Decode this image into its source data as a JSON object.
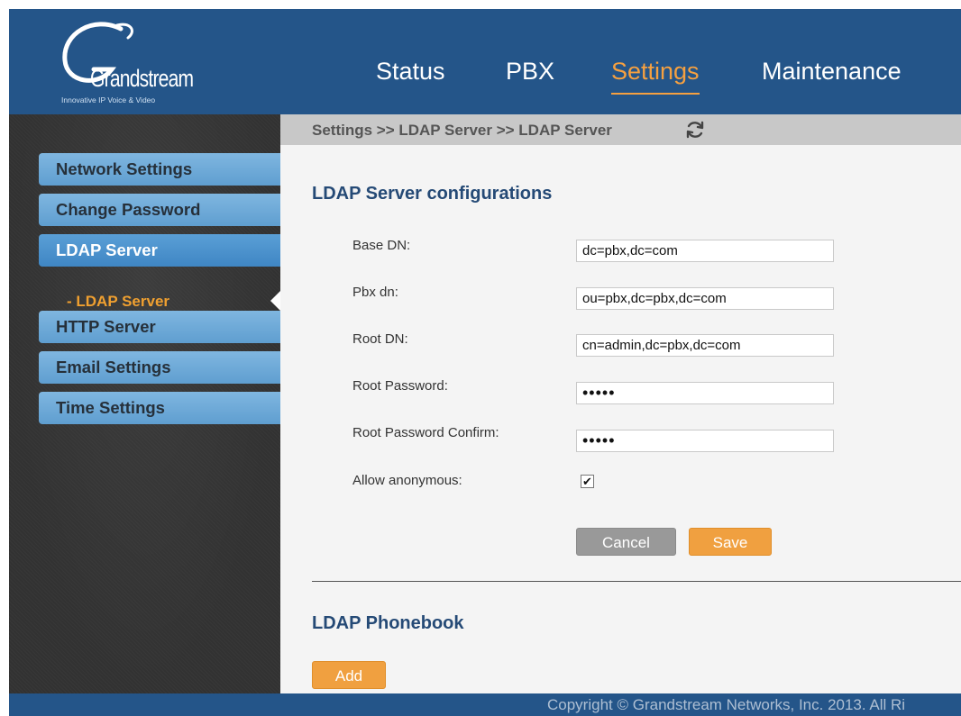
{
  "header": {
    "logo_text": "Grandstream",
    "logo_tagline": "Innovative IP Voice & Video",
    "nav": [
      {
        "label": "Status",
        "active": false
      },
      {
        "label": "PBX",
        "active": false
      },
      {
        "label": "Settings",
        "active": true
      },
      {
        "label": "Maintenance",
        "active": false
      }
    ]
  },
  "sidebar": {
    "items": [
      {
        "label": "Network Settings"
      },
      {
        "label": "Change Password"
      },
      {
        "label": "LDAP Server",
        "active": true
      },
      {
        "label": "HTTP Server"
      },
      {
        "label": "Email Settings"
      },
      {
        "label": "Time Settings"
      }
    ],
    "sub_item": "- LDAP Server"
  },
  "breadcrumb": "Settings >> LDAP Server >> LDAP Server",
  "main": {
    "section_title": "LDAP Server configurations",
    "fields": [
      {
        "label": "Base DN:",
        "value": "dc=pbx,dc=com"
      },
      {
        "label": "Pbx dn:",
        "value": "ou=pbx,dc=pbx,dc=com"
      },
      {
        "label": "Root DN:",
        "value": "cn=admin,dc=pbx,dc=com"
      },
      {
        "label": "Root Password:",
        "value": "•••••"
      },
      {
        "label": "Root Password Confirm:",
        "value": "•••••"
      }
    ],
    "allow_anonymous_label": "Allow anonymous:",
    "allow_anonymous_checked": true,
    "cancel_label": "Cancel",
    "save_label": "Save",
    "phonebook_title": "LDAP Phonebook",
    "add_label": "Add"
  },
  "footer": {
    "copyright": "Copyright © Grandstream Networks, Inc. 2013. All Ri"
  },
  "colors": {
    "header_bg": "#245589",
    "accent_orange": "#f0a040",
    "menu_blue": "#6aa8d8",
    "section_title": "#254a76"
  },
  "icons": {
    "refresh": "refresh-icon",
    "checkbox": "checkbox-checked"
  }
}
